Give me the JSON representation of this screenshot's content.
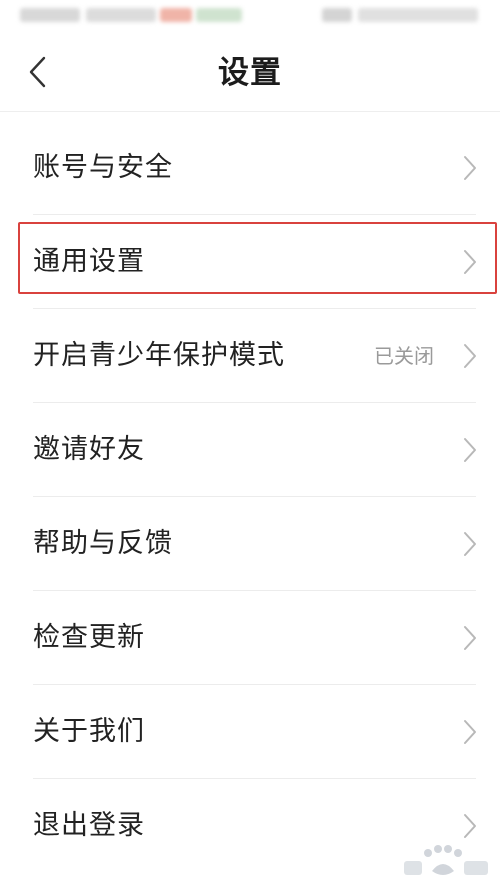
{
  "header": {
    "title": "设置"
  },
  "menu": {
    "items": [
      {
        "label": "账号与安全"
      },
      {
        "label": "通用设置"
      },
      {
        "label": "开启青少年保护模式",
        "status": "已关闭"
      },
      {
        "label": "邀请好友"
      },
      {
        "label": "帮助与反馈"
      },
      {
        "label": "检查更新"
      },
      {
        "label": "关于我们"
      },
      {
        "label": "退出登录"
      }
    ]
  },
  "icons": {
    "back": "chevron-left-icon",
    "item_arrow": "chevron-right-icon"
  },
  "colors": {
    "highlight_border": "#d9423e",
    "divider": "#ececec",
    "chevron": "#b8b8b8",
    "status_text": "#9a9a9a"
  }
}
